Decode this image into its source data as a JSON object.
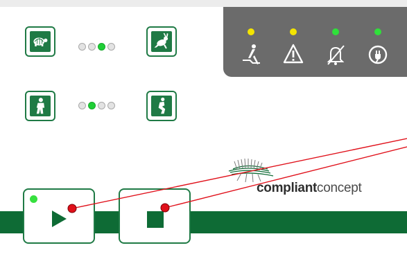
{
  "speed_control": {
    "slow_icon": "turtle-icon",
    "fast_icon": "rabbit-icon",
    "dots": [
      false,
      false,
      true,
      false
    ]
  },
  "stride_control": {
    "short_icon": "walking-figure-icon",
    "long_icon": "crouching-figure-icon",
    "dots": [
      false,
      true,
      false,
      false
    ]
  },
  "status_indicators": [
    {
      "icon": "person-reclining-icon",
      "led_color": "#f3e400"
    },
    {
      "icon": "warning-triangle-icon",
      "led_color": "#f3e400"
    },
    {
      "icon": "alarm-muted-bell-icon",
      "led_color": "#2fe03a"
    },
    {
      "icon": "power-plug-icon",
      "led_color": "#2fe03a"
    }
  ],
  "logo": {
    "text_bold": "compliant",
    "text_light": "concept"
  },
  "controls": {
    "play_icon": "play-icon",
    "stop_icon": "stop-icon",
    "power_led_color": "#37e03f"
  },
  "colors": {
    "brand_green": "#0e6b35",
    "border_green": "#1f7a45",
    "panel_gray": "#6b6b6b",
    "annotation_red": "#e0101a"
  }
}
